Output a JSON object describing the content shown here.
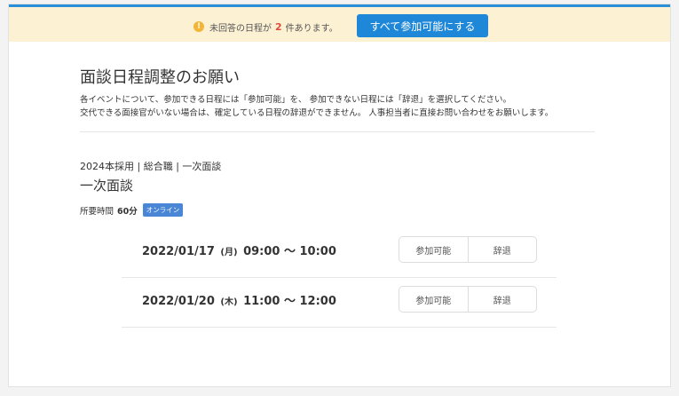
{
  "notice": {
    "icon": "info-warning-icon",
    "message_before": "未回答の日程が",
    "count": "2",
    "message_after": "件あります。",
    "accept_all_label": "すべて参加可能にする"
  },
  "page": {
    "title": "面談日程調整のお願い",
    "desc_line1": "各イベントについて、参加できる日程には「参加可能」を、 参加できない日程には「辞退」を選択してください。",
    "desc_line2": "交代できる面接官がいない場合は、確定している日程の辞退ができません。 人事担当者に直接お問い合わせをお願いします。"
  },
  "event": {
    "breadcrumb": "2024本採用 | 総合職 | 一次面談",
    "name": "一次面談",
    "duration_label": "所要時間",
    "duration_value": "60分",
    "mode_badge": "オンライン"
  },
  "slots": [
    {
      "date": "2022/01/17",
      "dow": "(月)",
      "time": "09:00 ～ 10:00",
      "accept": "参加可能",
      "decline": "辞退"
    },
    {
      "date": "2022/01/20",
      "dow": "(木)",
      "time": "11:00 ～ 12:00",
      "accept": "参加可能",
      "decline": "辞退"
    }
  ],
  "colors": {
    "accent": "#1f87d8",
    "notice_bg": "#fdf1d4",
    "count": "#e14b3b",
    "badge": "#4a86d6"
  }
}
